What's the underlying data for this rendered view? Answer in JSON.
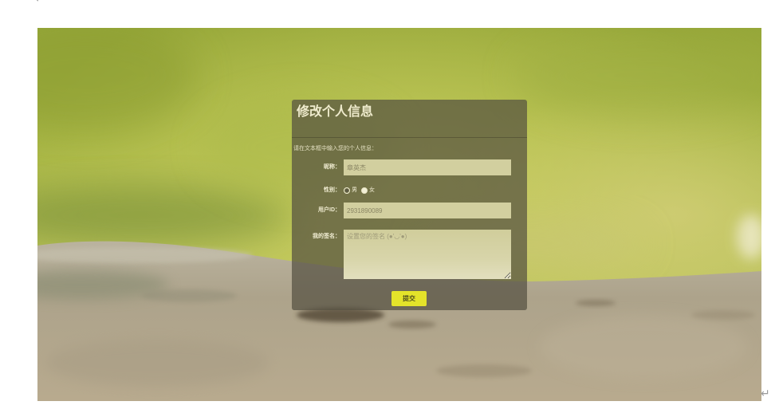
{
  "page": {
    "return_mark_top": "↵",
    "return_mark_bottom": "↵"
  },
  "dialog": {
    "title": "修改个人信息",
    "instruction": "请在文本框中输入您的个人信息：",
    "fields": {
      "nickname": {
        "label": "昵称：",
        "value": "章英杰"
      },
      "gender": {
        "label": "性别：",
        "options": [
          "男",
          "女"
        ],
        "selected": "男"
      },
      "user_id": {
        "label": "用户ID：",
        "value": "2931890089"
      },
      "signature": {
        "label": "我的签名：",
        "placeholder": "设置您的签名 (●'◡'●)"
      }
    },
    "submit_label": "提交"
  },
  "colors": {
    "submit_button": "#e4e32a",
    "dialog_text": "#efebcd"
  }
}
